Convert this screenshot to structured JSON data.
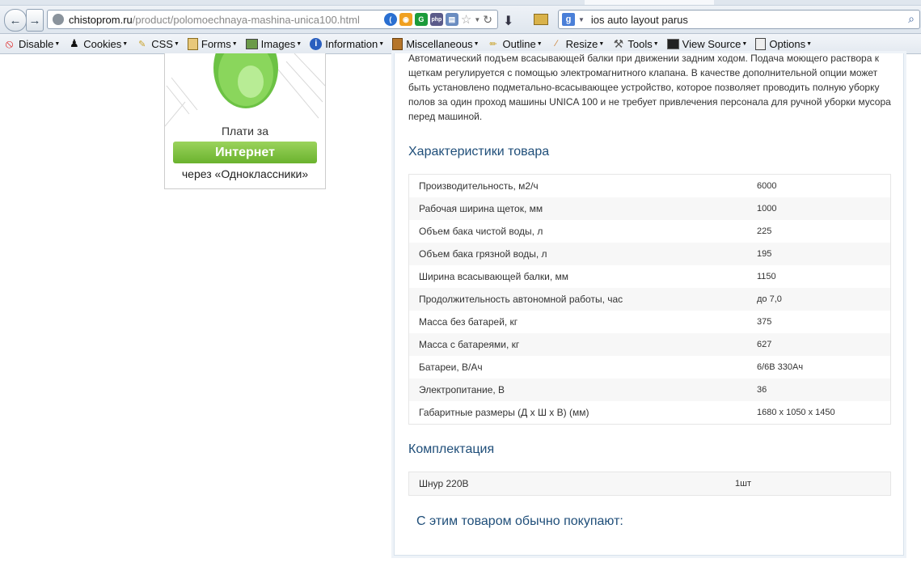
{
  "browser": {
    "url_host": "chistoprom.ru",
    "url_path": "/product/polomoechnaya-mashina-unica100.html",
    "search_text": "ios auto layout parus",
    "search_engine_icon": "google-icon"
  },
  "devtoolbar": {
    "items": [
      {
        "label": "Disable",
        "icon": "no-entry-icon"
      },
      {
        "label": "Cookies",
        "icon": "person-icon"
      },
      {
        "label": "CSS",
        "icon": "pencil-icon"
      },
      {
        "label": "Forms",
        "icon": "clipboard-icon"
      },
      {
        "label": "Images",
        "icon": "picture-icon"
      },
      {
        "label": "Information",
        "icon": "info-icon"
      },
      {
        "label": "Miscellaneous",
        "icon": "book-icon"
      },
      {
        "label": "Outline",
        "icon": "pen-icon"
      },
      {
        "label": "Resize",
        "icon": "ruler-icon"
      },
      {
        "label": "Tools",
        "icon": "wrench-icon"
      },
      {
        "label": "View Source",
        "icon": "terminal-icon"
      },
      {
        "label": "Options",
        "icon": "document-icon"
      }
    ]
  },
  "ad": {
    "pay_text": "Плати за",
    "button_label": "Интернет",
    "via_text": "через «Одноклассники»"
  },
  "product": {
    "description": "Автоматический подъем всасывающей балки при движении задним ходом. Подача моющего раствора к щеткам регулируется с помощью электромагнитного клапана. В качестве дополнительной опции может быть установлено подметально-всасывающее устройство, которое позволяет проводить полную уборку полов за один проход машины UNICA 100 и не требует привлечения персонала для ручной уборки мусора перед машиной.",
    "specs_title": "Характеристики товара",
    "specs": [
      {
        "name": "Производительность, м2/ч",
        "value": "6000"
      },
      {
        "name": "Рабочая ширина щеток, мм",
        "value": "1000"
      },
      {
        "name": "Объем бака чистой воды, л",
        "value": "225"
      },
      {
        "name": "Объем бака грязной воды, л",
        "value": "195"
      },
      {
        "name": "Ширина всасывающей балки, мм",
        "value": "1150"
      },
      {
        "name": "Продолжительность автономной работы, час",
        "value": "до 7,0"
      },
      {
        "name": "Масса без батарей, кг",
        "value": "375"
      },
      {
        "name": "Масса с батареями, кг",
        "value": "627"
      },
      {
        "name": "Батареи, В/Ач",
        "value": "6/6В 330Ач"
      },
      {
        "name": "Электропитание, В",
        "value": "36"
      },
      {
        "name": "Габаритные размеры (Д х Ш х В) (мм)",
        "value": "1680 х 1050 х 1450"
      }
    ],
    "kit_title": "Комплектация",
    "kit": [
      {
        "name": "Шнур 220В",
        "value": "1шт"
      }
    ],
    "also_bought_title": "С этим товаром обычно покупают:"
  },
  "colors": {
    "heading": "#1f4e79",
    "ad_button": "#7dbf3a"
  }
}
